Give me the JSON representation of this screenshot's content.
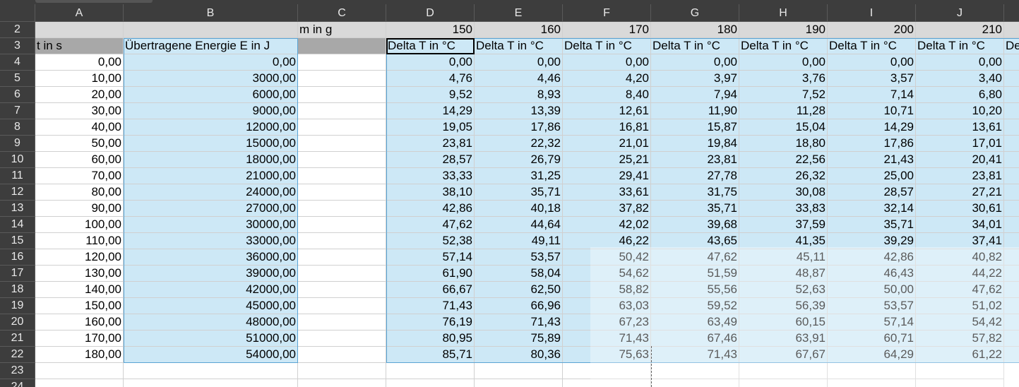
{
  "columns": [
    "A",
    "B",
    "C",
    "D",
    "E",
    "F",
    "G",
    "H",
    "I",
    "J"
  ],
  "rows": [
    "2",
    "3",
    "4",
    "5",
    "6",
    "7",
    "8",
    "9",
    "10",
    "11",
    "12",
    "13",
    "14",
    "15",
    "16",
    "17",
    "18",
    "19",
    "20",
    "21",
    "22",
    "23",
    "24"
  ],
  "row2": {
    "c_label": "m in g",
    "masses": [
      "150",
      "160",
      "170",
      "180",
      "190",
      "200",
      "210"
    ]
  },
  "row3": {
    "a_label": "t in s",
    "b_label": "Übertragene Energie E in J",
    "delta_labels": [
      "Delta T in °C",
      "Delta T in °C",
      "Delta T in °C",
      "Delta T in °C",
      "Delta T in °C",
      "Delta T in °C",
      "Delta T in °C"
    ],
    "overflow": "De"
  },
  "data": [
    [
      "0,00",
      "0,00",
      "0,00",
      "0,00",
      "0,00",
      "0,00",
      "0,00",
      "0,00",
      "0,00"
    ],
    [
      "10,00",
      "3000,00",
      "4,76",
      "4,46",
      "4,20",
      "3,97",
      "3,76",
      "3,57",
      "3,40"
    ],
    [
      "20,00",
      "6000,00",
      "9,52",
      "8,93",
      "8,40",
      "7,94",
      "7,52",
      "7,14",
      "6,80"
    ],
    [
      "30,00",
      "9000,00",
      "14,29",
      "13,39",
      "12,61",
      "11,90",
      "11,28",
      "10,71",
      "10,20"
    ],
    [
      "40,00",
      "12000,00",
      "19,05",
      "17,86",
      "16,81",
      "15,87",
      "15,04",
      "14,29",
      "13,61"
    ],
    [
      "50,00",
      "15000,00",
      "23,81",
      "22,32",
      "21,01",
      "19,84",
      "18,80",
      "17,86",
      "17,01"
    ],
    [
      "60,00",
      "18000,00",
      "28,57",
      "26,79",
      "25,21",
      "23,81",
      "22,56",
      "21,43",
      "20,41"
    ],
    [
      "70,00",
      "21000,00",
      "33,33",
      "31,25",
      "29,41",
      "27,78",
      "26,32",
      "25,00",
      "23,81"
    ],
    [
      "80,00",
      "24000,00",
      "38,10",
      "35,71",
      "33,61",
      "31,75",
      "30,08",
      "28,57",
      "27,21"
    ],
    [
      "90,00",
      "27000,00",
      "42,86",
      "40,18",
      "37,82",
      "35,71",
      "33,83",
      "32,14",
      "30,61"
    ],
    [
      "100,00",
      "30000,00",
      "47,62",
      "44,64",
      "42,02",
      "39,68",
      "37,59",
      "35,71",
      "34,01"
    ],
    [
      "110,00",
      "33000,00",
      "52,38",
      "49,11",
      "46,22",
      "43,65",
      "41,35",
      "39,29",
      "37,41"
    ],
    [
      "120,00",
      "36000,00",
      "57,14",
      "53,57",
      "50,42",
      "47,62",
      "45,11",
      "42,86",
      "40,82"
    ],
    [
      "130,00",
      "39000,00",
      "61,90",
      "58,04",
      "54,62",
      "51,59",
      "48,87",
      "46,43",
      "44,22"
    ],
    [
      "140,00",
      "42000,00",
      "66,67",
      "62,50",
      "58,82",
      "55,56",
      "52,63",
      "50,00",
      "47,62"
    ],
    [
      "150,00",
      "45000,00",
      "71,43",
      "66,96",
      "63,03",
      "59,52",
      "56,39",
      "53,57",
      "51,02"
    ],
    [
      "160,00",
      "48000,00",
      "76,19",
      "71,43",
      "67,23",
      "63,49",
      "60,15",
      "57,14",
      "54,42"
    ],
    [
      "170,00",
      "51000,00",
      "80,95",
      "75,89",
      "71,43",
      "67,46",
      "63,91",
      "60,71",
      "57,82"
    ],
    [
      "180,00",
      "54000,00",
      "85,71",
      "80,36",
      "75,63",
      "71,43",
      "67,67",
      "64,29",
      "61,22"
    ]
  ],
  "colors": {
    "header_bg": "#3d3d3d",
    "selection_bg": "#cde8f6",
    "selection_border": "#5aa4d4",
    "row2_bg": "#d9d9d9",
    "row3_bg": "#a8a8a8"
  },
  "active_cell": "D3"
}
